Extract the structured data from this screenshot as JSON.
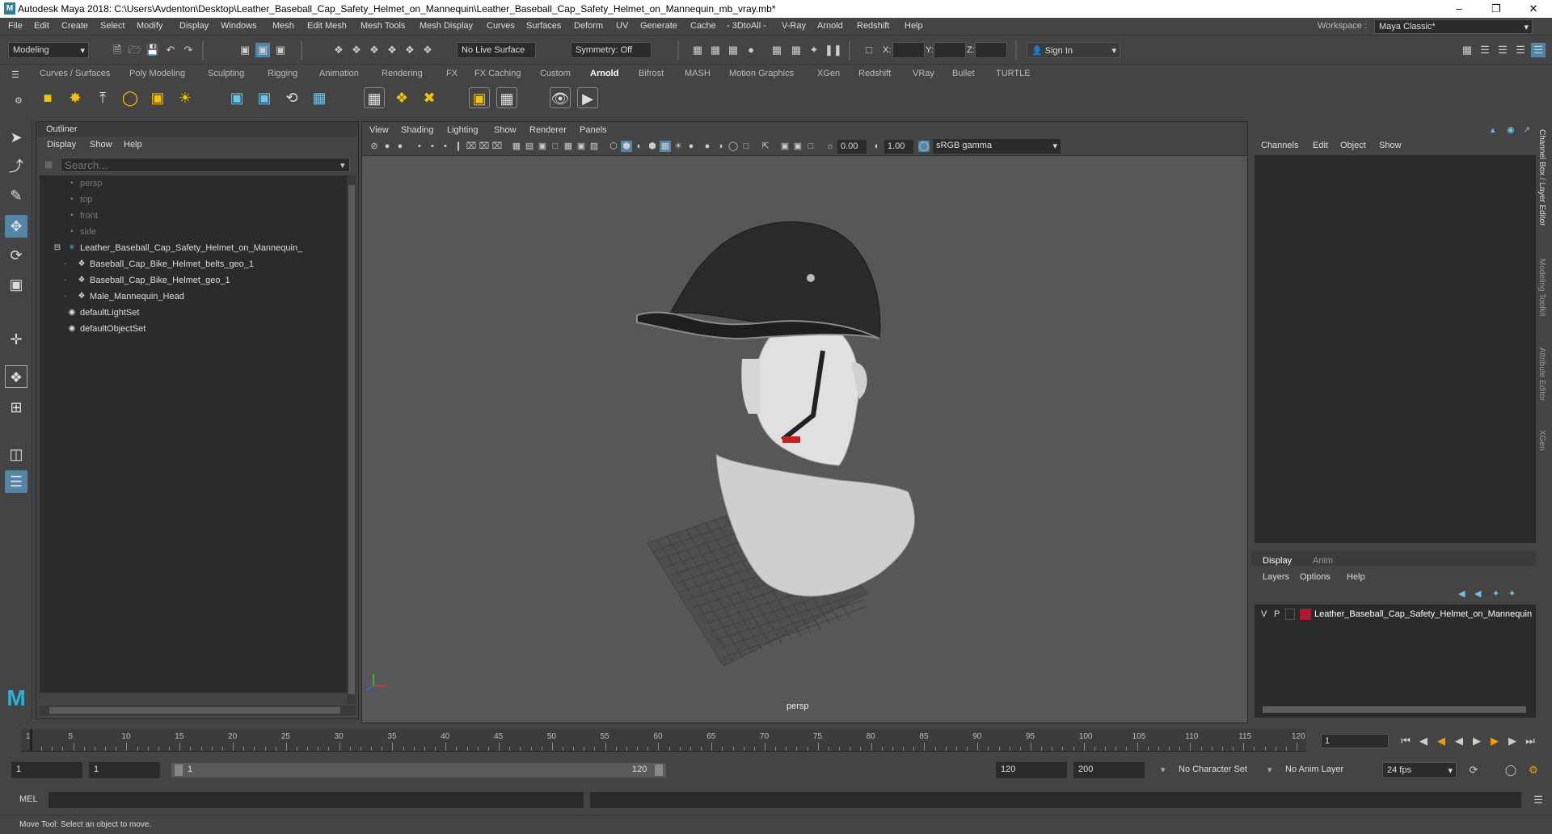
{
  "window": {
    "title": "Autodesk Maya 2018: C:\\Users\\Avdenton\\Desktop\\Leather_Baseball_Cap_Safety_Helmet_on_Mannequin\\Leather_Baseball_Cap_Safety_Helmet_on_Mannequin_mb_vray.mb*",
    "logo": "M"
  },
  "menubar": {
    "items": [
      "File",
      "Edit",
      "Create",
      "Select",
      "Modify",
      "Display",
      "Windows",
      "Mesh",
      "Edit Mesh",
      "Mesh Tools",
      "Mesh Display",
      "Curves",
      "Surfaces",
      "Deform",
      "UV",
      "Generate",
      "Cache",
      "- 3DtoAll -",
      "V-Ray",
      "Arnold",
      "Redshift",
      "Help"
    ],
    "workspace_label": "Workspace :",
    "workspace_value": "Maya Classic*"
  },
  "toolbar": {
    "mode": "Modeling",
    "live_surface": "No Live Surface",
    "symmetry": "Symmetry: Off",
    "x_label": "X:",
    "y_label": "Y:",
    "z_label": "Z:",
    "sign_in": "Sign In"
  },
  "shelf": {
    "tabs": [
      "Curves / Surfaces",
      "Poly Modeling",
      "Sculpting",
      "Rigging",
      "Animation",
      "Rendering",
      "FX",
      "FX Caching",
      "Custom",
      "Arnold",
      "Bifrost",
      "MASH",
      "Motion Graphics",
      "XGen",
      "Redshift",
      "VRay",
      "Bullet",
      "TURTLE"
    ],
    "active_tab": "Arnold"
  },
  "outliner": {
    "title": "Outliner",
    "menu": [
      "Display",
      "Show",
      "Help"
    ],
    "search_placeholder": "Search...",
    "items": [
      {
        "label": "persp",
        "type": "camera"
      },
      {
        "label": "top",
        "type": "camera"
      },
      {
        "label": "front",
        "type": "camera"
      },
      {
        "label": "side",
        "type": "camera"
      },
      {
        "label": "Leather_Baseball_Cap_Safety_Helmet_on_Mannequin_",
        "type": "group"
      },
      {
        "label": "Baseball_Cap_Bike_Helmet_belts_geo_1",
        "type": "mesh"
      },
      {
        "label": "Baseball_Cap_Bike_Helmet_geo_1",
        "type": "mesh"
      },
      {
        "label": "Male_Mannequin_Head",
        "type": "mesh"
      },
      {
        "label": "defaultLightSet",
        "type": "set"
      },
      {
        "label": "defaultObjectSet",
        "type": "set"
      }
    ]
  },
  "viewport": {
    "menu": [
      "View",
      "Shading",
      "Lighting",
      "Show",
      "Renderer",
      "Panels"
    ],
    "exposure": "0.00",
    "gamma": "1.00",
    "color_space": "sRGB gamma",
    "camera_label": "persp"
  },
  "channel_box": {
    "menu": [
      "Channels",
      "Edit",
      "Object",
      "Show"
    ]
  },
  "layer_editor": {
    "tabs": [
      "Display",
      "Anim"
    ],
    "active_tab": "Display",
    "menu": [
      "Layers",
      "Options",
      "Help"
    ],
    "layer": {
      "v": "V",
      "p": "P",
      "name": "Leather_Baseball_Cap_Safety_Helmet_on_Mannequin",
      "color": "#b0182e"
    }
  },
  "side_tabs": [
    "Channel Box / Layer Editor",
    "Modeling Toolkit",
    "Attribute Editor",
    "XGen"
  ],
  "timeline": {
    "ticks": [
      "1",
      "5",
      "10",
      "15",
      "20",
      "25",
      "30",
      "35",
      "40",
      "45",
      "50",
      "55",
      "60",
      "65",
      "70",
      "75",
      "80",
      "85",
      "90",
      "95",
      "100",
      "105",
      "110",
      "115",
      "120"
    ],
    "current_frame": "1"
  },
  "range": {
    "start": "1",
    "start2": "1",
    "slider_start": "1",
    "slider_end": "120",
    "end": "120",
    "end2": "200",
    "character_set": "No Character Set",
    "anim_layer": "No Anim Layer",
    "fps": "24 fps"
  },
  "command": {
    "label": "MEL"
  },
  "status": {
    "text": "Move Tool: Select an object to move."
  },
  "colors": {
    "accent": "#5285a6",
    "bg": "#444444",
    "panel": "#2b2b2b"
  }
}
